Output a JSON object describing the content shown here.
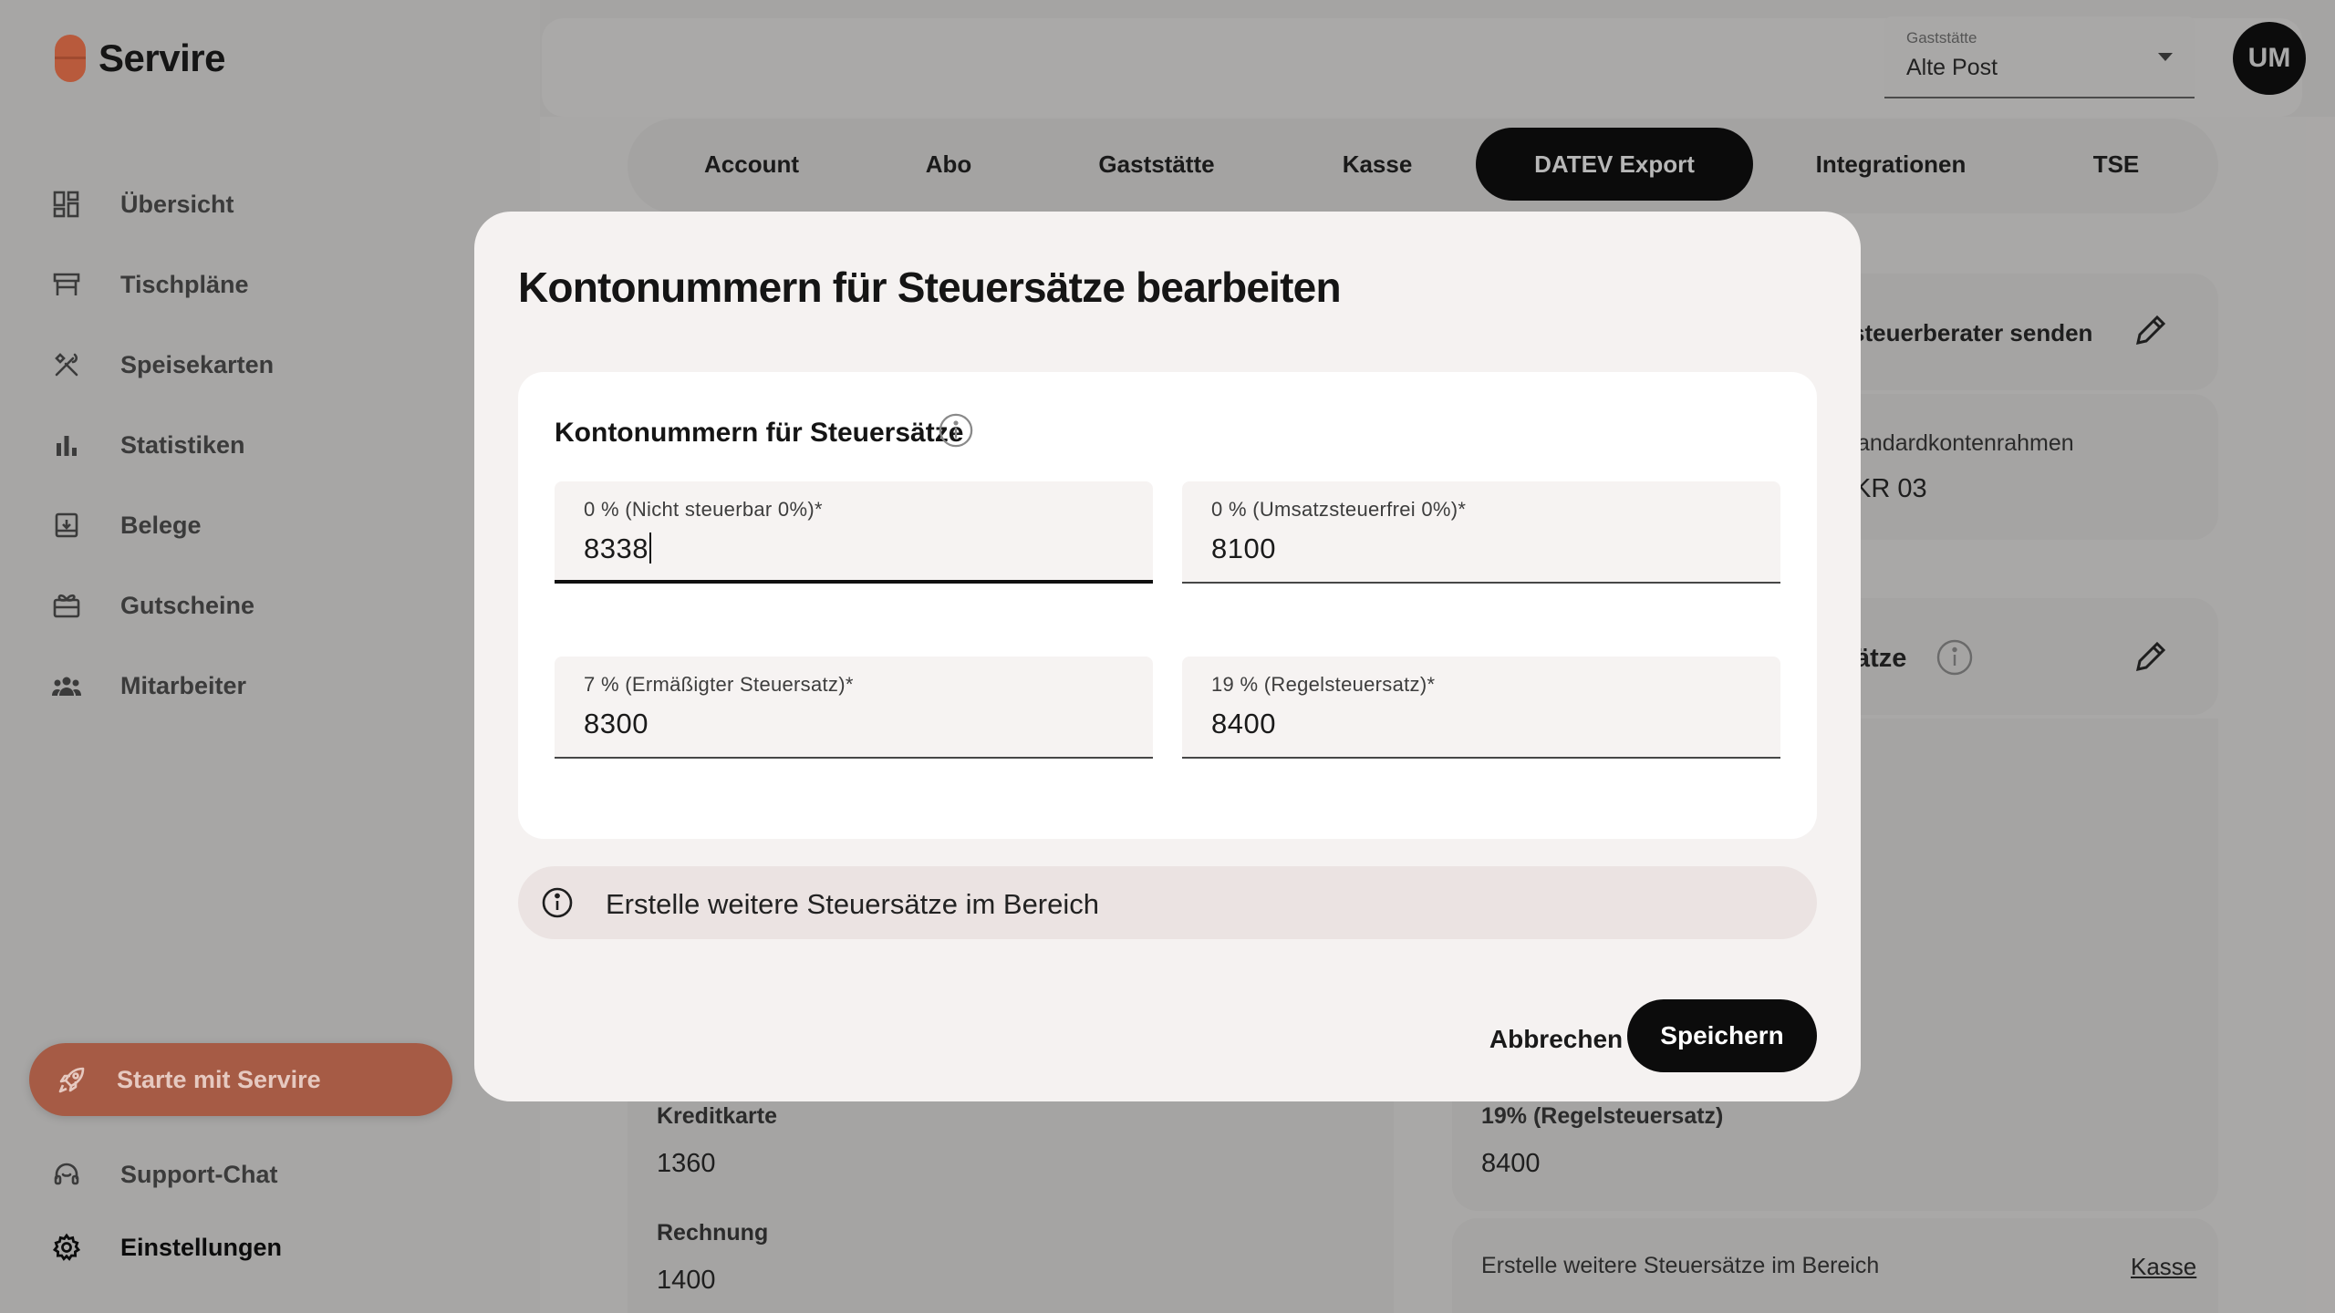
{
  "app": {
    "name": "Servire"
  },
  "sidebar": {
    "items": [
      {
        "label": "Übersicht",
        "icon": "dashboard-icon"
      },
      {
        "label": "Tischpläne",
        "icon": "table-icon"
      },
      {
        "label": "Speisekarten",
        "icon": "cutlery-icon"
      },
      {
        "label": "Statistiken",
        "icon": "bar-chart-icon"
      },
      {
        "label": "Belege",
        "icon": "receipt-icon"
      },
      {
        "label": "Gutscheine",
        "icon": "gift-card-icon"
      },
      {
        "label": "Mitarbeiter",
        "icon": "team-icon"
      }
    ],
    "start_label": "Starte mit Servire",
    "support_label": "Support-Chat",
    "settings_label": "Einstellungen"
  },
  "header": {
    "venue_caption": "Gaststätte",
    "venue_value": "Alte Post",
    "avatar_initials": "UM"
  },
  "tabs": [
    {
      "label": "Account",
      "active": false
    },
    {
      "label": "Abo",
      "active": false
    },
    {
      "label": "Gaststätte",
      "active": false
    },
    {
      "label": "Kasse",
      "active": false
    },
    {
      "label": "DATEV Export",
      "active": true
    },
    {
      "label": "Integrationen",
      "active": false
    },
    {
      "label": "TSE",
      "active": false
    }
  ],
  "background": {
    "send_label": "steuerberater senden",
    "kontenrahmen_label": "andardkontenrahmen",
    "kontenrahmen_value": "KR 03",
    "steuersaetze_label": "ätze",
    "kreditkarte_label": "Kreditkarte",
    "kreditkarte_value": "1360",
    "rechnung_label": "Rechnung",
    "rechnung_value": "1400",
    "regelsteuer_label": "19% (Regelsteuersatz)",
    "regelsteuer_value": "8400",
    "hint_text": "Erstelle weitere Steuersätze im Bereich",
    "hint_link": "Kasse"
  },
  "modal": {
    "title": "Kontonummern für Steuersätze bearbeiten",
    "section_title": "Kontonummern für Steuersätze",
    "fields": [
      {
        "label": "0 % (Nicht steuerbar 0%)*",
        "value": "8338"
      },
      {
        "label": "0 % (Umsatzsteuerfrei 0%)*",
        "value": "8100"
      },
      {
        "label": "7 % (Ermäßigter Steuersatz)*",
        "value": "8300"
      },
      {
        "label": "19 % (Regelsteuersatz)*",
        "value": "8400"
      }
    ],
    "notice": "Erstelle weitere Steuersätze im Bereich",
    "cancel_label": "Abbrechen",
    "save_label": "Speichern"
  }
}
